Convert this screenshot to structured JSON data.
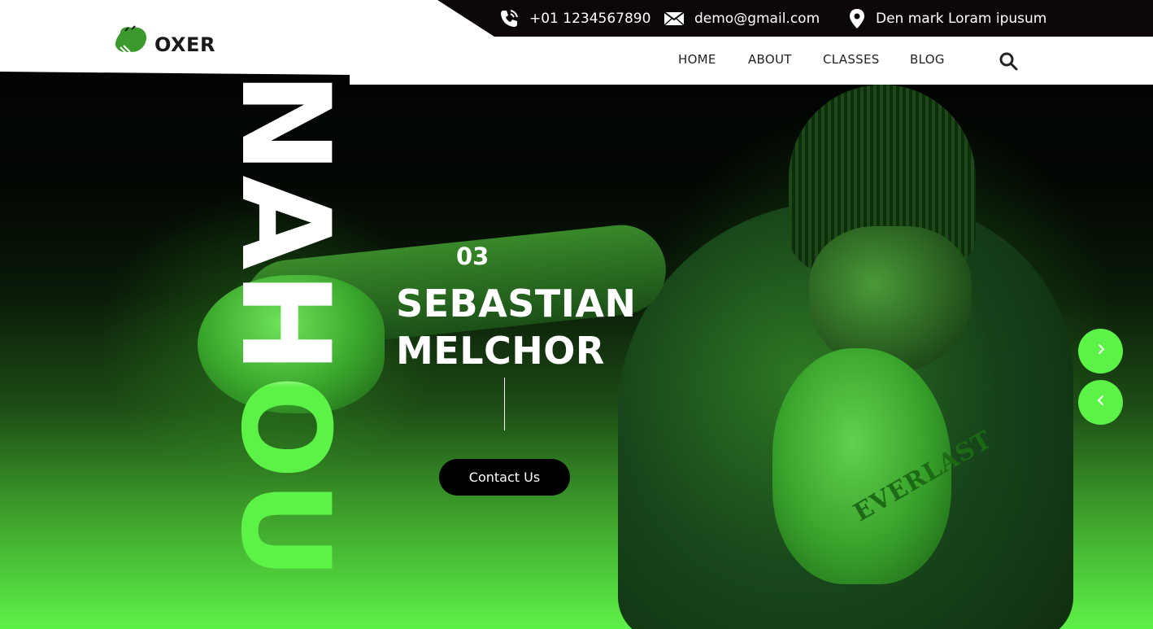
{
  "brand": {
    "name": "OXER",
    "logo_icon": "boxing-glove-icon"
  },
  "topbar": {
    "phone": "+01 1234567890",
    "phone_icon": "phone-icon",
    "email": "demo@gmail.com",
    "email_icon": "envelope-icon",
    "location": "Den mark Loram ipusum",
    "location_icon": "map-pin-icon"
  },
  "nav": {
    "items": [
      {
        "label": "HOME"
      },
      {
        "label": "ABOUT"
      },
      {
        "label": "CLASSES"
      },
      {
        "label": "BLOG"
      }
    ],
    "search_icon": "search-icon"
  },
  "hero": {
    "vertical_word": "NAHOU",
    "slide_number": "03",
    "title_line1": "SEBASTIAN",
    "title_line2": "MELCHOR",
    "cta_label": "Contact Us",
    "glove_brand": "EVERLAST",
    "next_icon": "chevron-right-icon",
    "prev_icon": "chevron-left-icon"
  },
  "colors": {
    "accent": "#5df248",
    "topbar_bg": "#0d0606",
    "button_bg": "#000000"
  }
}
